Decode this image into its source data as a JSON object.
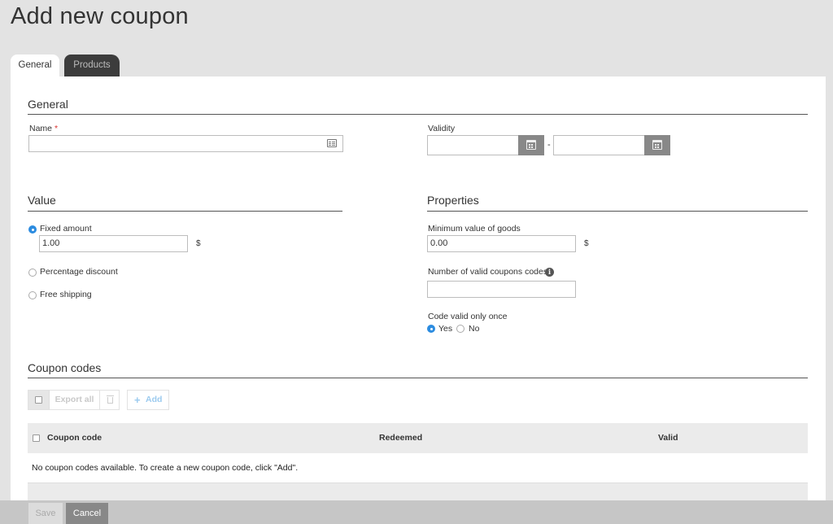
{
  "page": {
    "title": "Add new coupon"
  },
  "tabs": [
    {
      "label": "General",
      "active": true
    },
    {
      "label": "Products",
      "active": false
    }
  ],
  "general": {
    "title": "General",
    "name": {
      "label": "Name",
      "required_mark": "*",
      "value": ""
    },
    "validity": {
      "label": "Validity",
      "from": "",
      "to": "",
      "separator": "-"
    }
  },
  "value": {
    "title": "Value",
    "options": [
      {
        "label": "Fixed amount",
        "checked": true
      },
      {
        "label": "Percentage discount",
        "checked": false
      },
      {
        "label": "Free shipping",
        "checked": false
      }
    ],
    "fixed_amount": {
      "value": "1.00",
      "unit": "$"
    }
  },
  "properties": {
    "title": "Properties",
    "min_value": {
      "label": "Minimum value of goods",
      "value": "0.00",
      "unit": "$"
    },
    "valid_codes": {
      "label": "Number of valid coupons codes",
      "value": "",
      "info_glyph": "i"
    },
    "valid_once": {
      "label": "Code valid only once",
      "options": [
        {
          "label": "Yes",
          "checked": true
        },
        {
          "label": "No",
          "checked": false
        }
      ]
    }
  },
  "coupon_codes": {
    "title": "Coupon codes",
    "toolbar": {
      "export_all": "Export all",
      "add": "Add",
      "add_glyph": "+"
    },
    "columns": [
      "Coupon code",
      "Redeemed",
      "Valid"
    ],
    "empty_message": "No coupon codes available. To create a new coupon code, click \"Add\"."
  },
  "footer": {
    "save": "Save",
    "cancel": "Cancel"
  },
  "colors": {
    "accent": "#2c8ce0",
    "dark_tab": "#3c3c3c",
    "required": "#d9312f"
  }
}
